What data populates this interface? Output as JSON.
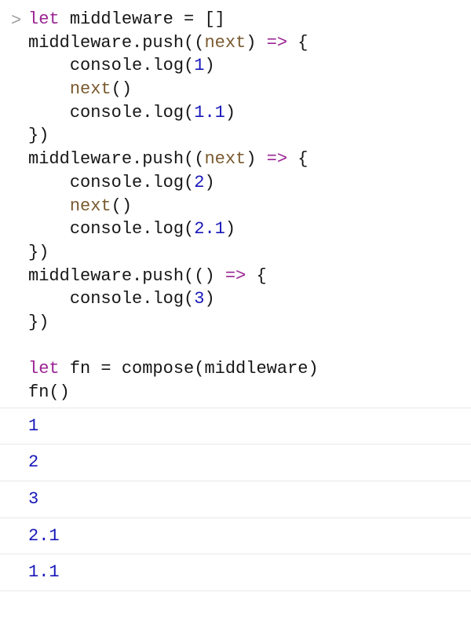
{
  "input": {
    "prompt": ">",
    "code": [
      [
        {
          "t": "let",
          "c": "keyword"
        },
        {
          "t": " "
        },
        {
          "t": "middleware",
          "c": "ident"
        },
        {
          "t": " "
        },
        {
          "t": "=",
          "c": "punct"
        },
        {
          "t": " "
        },
        {
          "t": "[",
          "c": "punct"
        },
        {
          "t": "]",
          "c": "punct"
        }
      ],
      [
        {
          "t": "middleware",
          "c": "ident"
        },
        {
          "t": ".",
          "c": "punct"
        },
        {
          "t": "push",
          "c": "ident"
        },
        {
          "t": "(",
          "c": "punct"
        },
        {
          "t": "(",
          "c": "punct"
        },
        {
          "t": "next",
          "c": "param"
        },
        {
          "t": ")",
          "c": "punct"
        },
        {
          "t": " "
        },
        {
          "t": "=>",
          "c": "arrow"
        },
        {
          "t": " "
        },
        {
          "t": "{",
          "c": "punct"
        }
      ],
      [
        {
          "t": "    "
        },
        {
          "t": "console",
          "c": "ident"
        },
        {
          "t": ".",
          "c": "punct"
        },
        {
          "t": "log",
          "c": "ident"
        },
        {
          "t": "(",
          "c": "punct"
        },
        {
          "t": "1",
          "c": "num"
        },
        {
          "t": ")",
          "c": "punct"
        }
      ],
      [
        {
          "t": "    "
        },
        {
          "t": "next",
          "c": "param"
        },
        {
          "t": "(",
          "c": "punct"
        },
        {
          "t": ")",
          "c": "punct"
        }
      ],
      [
        {
          "t": "    "
        },
        {
          "t": "console",
          "c": "ident"
        },
        {
          "t": ".",
          "c": "punct"
        },
        {
          "t": "log",
          "c": "ident"
        },
        {
          "t": "(",
          "c": "punct"
        },
        {
          "t": "1.1",
          "c": "num"
        },
        {
          "t": ")",
          "c": "punct"
        }
      ],
      [
        {
          "t": "}",
          "c": "punct"
        },
        {
          "t": ")",
          "c": "punct"
        }
      ],
      [
        {
          "t": "middleware",
          "c": "ident"
        },
        {
          "t": ".",
          "c": "punct"
        },
        {
          "t": "push",
          "c": "ident"
        },
        {
          "t": "(",
          "c": "punct"
        },
        {
          "t": "(",
          "c": "punct"
        },
        {
          "t": "next",
          "c": "param"
        },
        {
          "t": ")",
          "c": "punct"
        },
        {
          "t": " "
        },
        {
          "t": "=>",
          "c": "arrow"
        },
        {
          "t": " "
        },
        {
          "t": "{",
          "c": "punct"
        }
      ],
      [
        {
          "t": "    "
        },
        {
          "t": "console",
          "c": "ident"
        },
        {
          "t": ".",
          "c": "punct"
        },
        {
          "t": "log",
          "c": "ident"
        },
        {
          "t": "(",
          "c": "punct"
        },
        {
          "t": "2",
          "c": "num"
        },
        {
          "t": ")",
          "c": "punct"
        }
      ],
      [
        {
          "t": "    "
        },
        {
          "t": "next",
          "c": "param"
        },
        {
          "t": "(",
          "c": "punct"
        },
        {
          "t": ")",
          "c": "punct"
        }
      ],
      [
        {
          "t": "    "
        },
        {
          "t": "console",
          "c": "ident"
        },
        {
          "t": ".",
          "c": "punct"
        },
        {
          "t": "log",
          "c": "ident"
        },
        {
          "t": "(",
          "c": "punct"
        },
        {
          "t": "2.1",
          "c": "num"
        },
        {
          "t": ")",
          "c": "punct"
        }
      ],
      [
        {
          "t": "}",
          "c": "punct"
        },
        {
          "t": ")",
          "c": "punct"
        }
      ],
      [
        {
          "t": "middleware",
          "c": "ident"
        },
        {
          "t": ".",
          "c": "punct"
        },
        {
          "t": "push",
          "c": "ident"
        },
        {
          "t": "(",
          "c": "punct"
        },
        {
          "t": "(",
          "c": "punct"
        },
        {
          "t": ")",
          "c": "punct"
        },
        {
          "t": " "
        },
        {
          "t": "=>",
          "c": "arrow"
        },
        {
          "t": " "
        },
        {
          "t": "{",
          "c": "punct"
        }
      ],
      [
        {
          "t": "    "
        },
        {
          "t": "console",
          "c": "ident"
        },
        {
          "t": ".",
          "c": "punct"
        },
        {
          "t": "log",
          "c": "ident"
        },
        {
          "t": "(",
          "c": "punct"
        },
        {
          "t": "3",
          "c": "num"
        },
        {
          "t": ")",
          "c": "punct"
        }
      ],
      [
        {
          "t": "}",
          "c": "punct"
        },
        {
          "t": ")",
          "c": "punct"
        }
      ],
      [
        {
          "t": " "
        }
      ],
      [
        {
          "t": "let",
          "c": "keyword"
        },
        {
          "t": " "
        },
        {
          "t": "fn",
          "c": "ident"
        },
        {
          "t": " "
        },
        {
          "t": "=",
          "c": "punct"
        },
        {
          "t": " "
        },
        {
          "t": "compose",
          "c": "ident"
        },
        {
          "t": "(",
          "c": "punct"
        },
        {
          "t": "middleware",
          "c": "ident"
        },
        {
          "t": ")",
          "c": "punct"
        }
      ],
      [
        {
          "t": "fn",
          "c": "ident"
        },
        {
          "t": "(",
          "c": "punct"
        },
        {
          "t": ")",
          "c": "punct"
        }
      ]
    ]
  },
  "output": [
    "1",
    "2",
    "3",
    "2.1",
    "1.1"
  ]
}
